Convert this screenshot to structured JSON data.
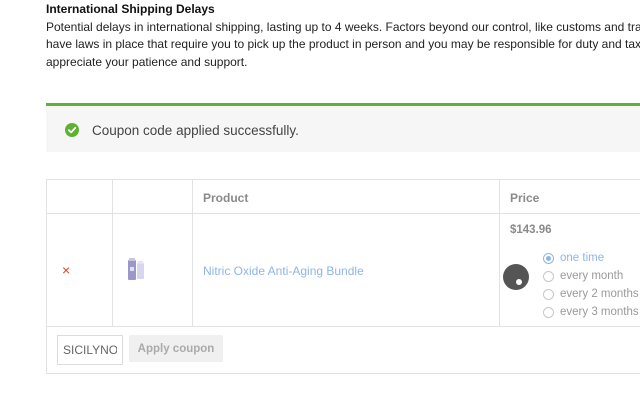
{
  "notice": {
    "title": "International Shipping Delays",
    "line1": "Potential delays in international shipping, lasting up to 4 weeks. Factors beyond our control, like customs and transpo",
    "line2": "have laws in place that require you to pick up the product in person and you may be responsible for duty and tax depe",
    "line3": "appreciate your patience and support."
  },
  "message": {
    "text": "Coupon code applied successfully.",
    "icon": "check-circle-icon",
    "accent": "#5fb131"
  },
  "cart": {
    "headers": {
      "remove": "",
      "thumbnail": "",
      "product": "Product",
      "price": "Price"
    },
    "item": {
      "remove_symbol": "×",
      "name": "Nitric Oxide Anti-Aging Bundle",
      "price": "$143.96",
      "purchase_options": [
        {
          "label": "one time",
          "selected": true
        },
        {
          "label": "every month",
          "selected": false
        },
        {
          "label": "every 2 months",
          "selected": false
        },
        {
          "label": "every 3 months",
          "selected": false
        }
      ]
    },
    "coupon": {
      "value": "SICILYNO",
      "apply_label": "Apply coupon"
    }
  }
}
